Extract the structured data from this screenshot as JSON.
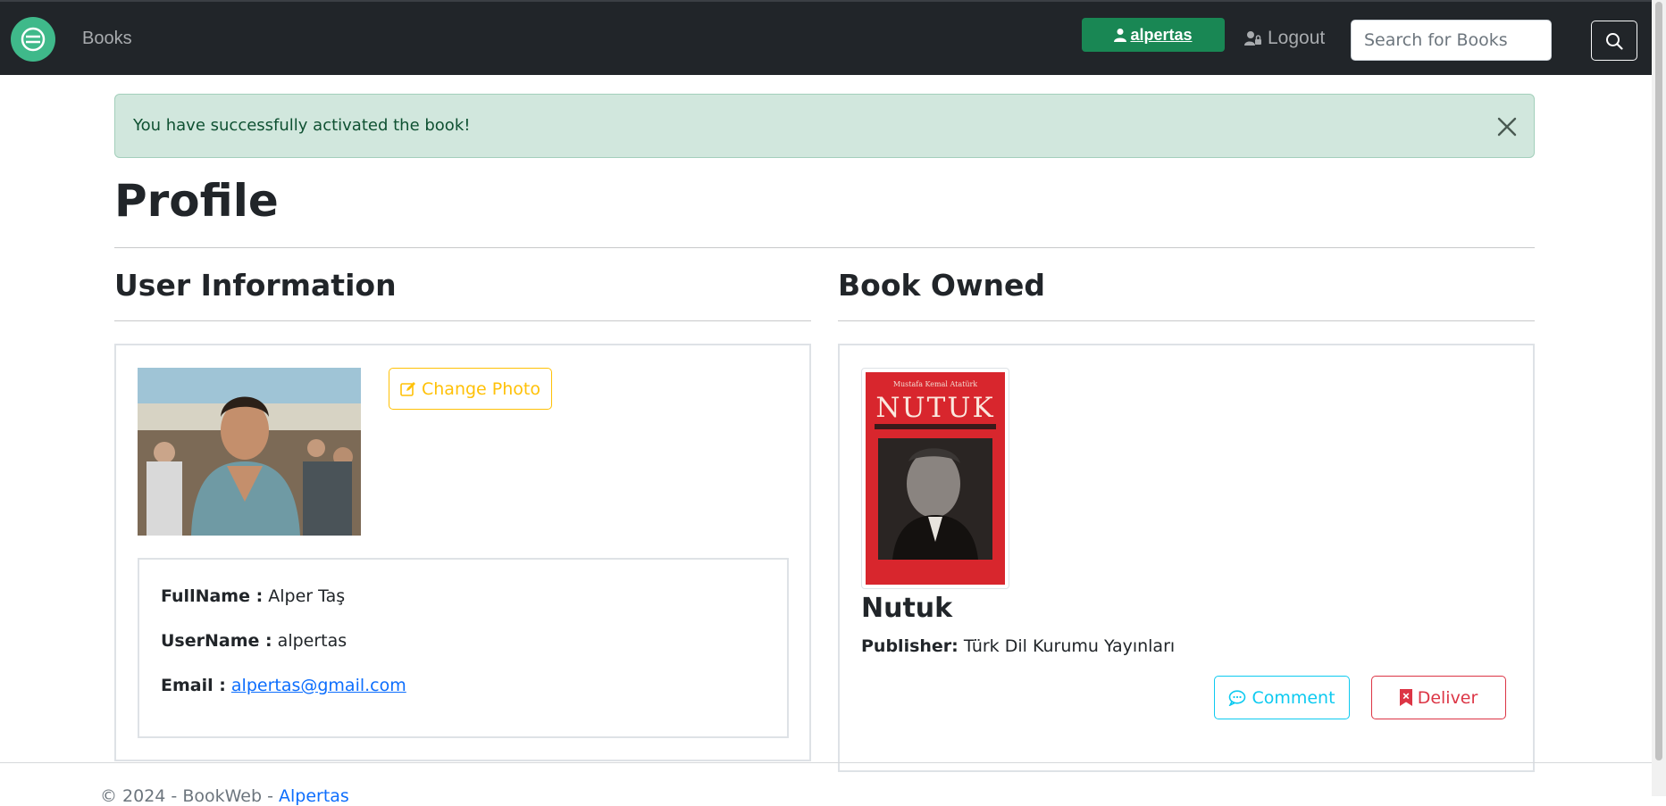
{
  "navbar": {
    "books_label": "Books",
    "username": "alpertas",
    "logout_label": "Logout",
    "search_placeholder": "Search for Books",
    "brand_color": "#212529",
    "user_button_color": "#198754"
  },
  "alert": {
    "message": "You have successfully activated the book!",
    "type": "success"
  },
  "page": {
    "title": "Profile"
  },
  "user_info": {
    "heading": "User Information",
    "change_photo_label": "Change Photo",
    "fullname_label": "FullName :",
    "fullname_value": "Alper Taş",
    "username_label": "UserName :",
    "username_value": "alpertas",
    "email_label": "Email :",
    "email_value": "alpertas@gmail.com"
  },
  "book_owned": {
    "heading": "Book Owned",
    "book": {
      "title": "Nutuk",
      "publisher_label": "Publisher:",
      "publisher_value": "Türk Dil Kurumu Yayınları",
      "cover_author": "Mustafa Kemal Atatürk",
      "cover_title": "NUTUK"
    },
    "comment_label": "Comment",
    "deliver_label": "Deliver"
  },
  "footer": {
    "text": "© 2024 - BookWeb - ",
    "link_text": "Alpertas"
  }
}
